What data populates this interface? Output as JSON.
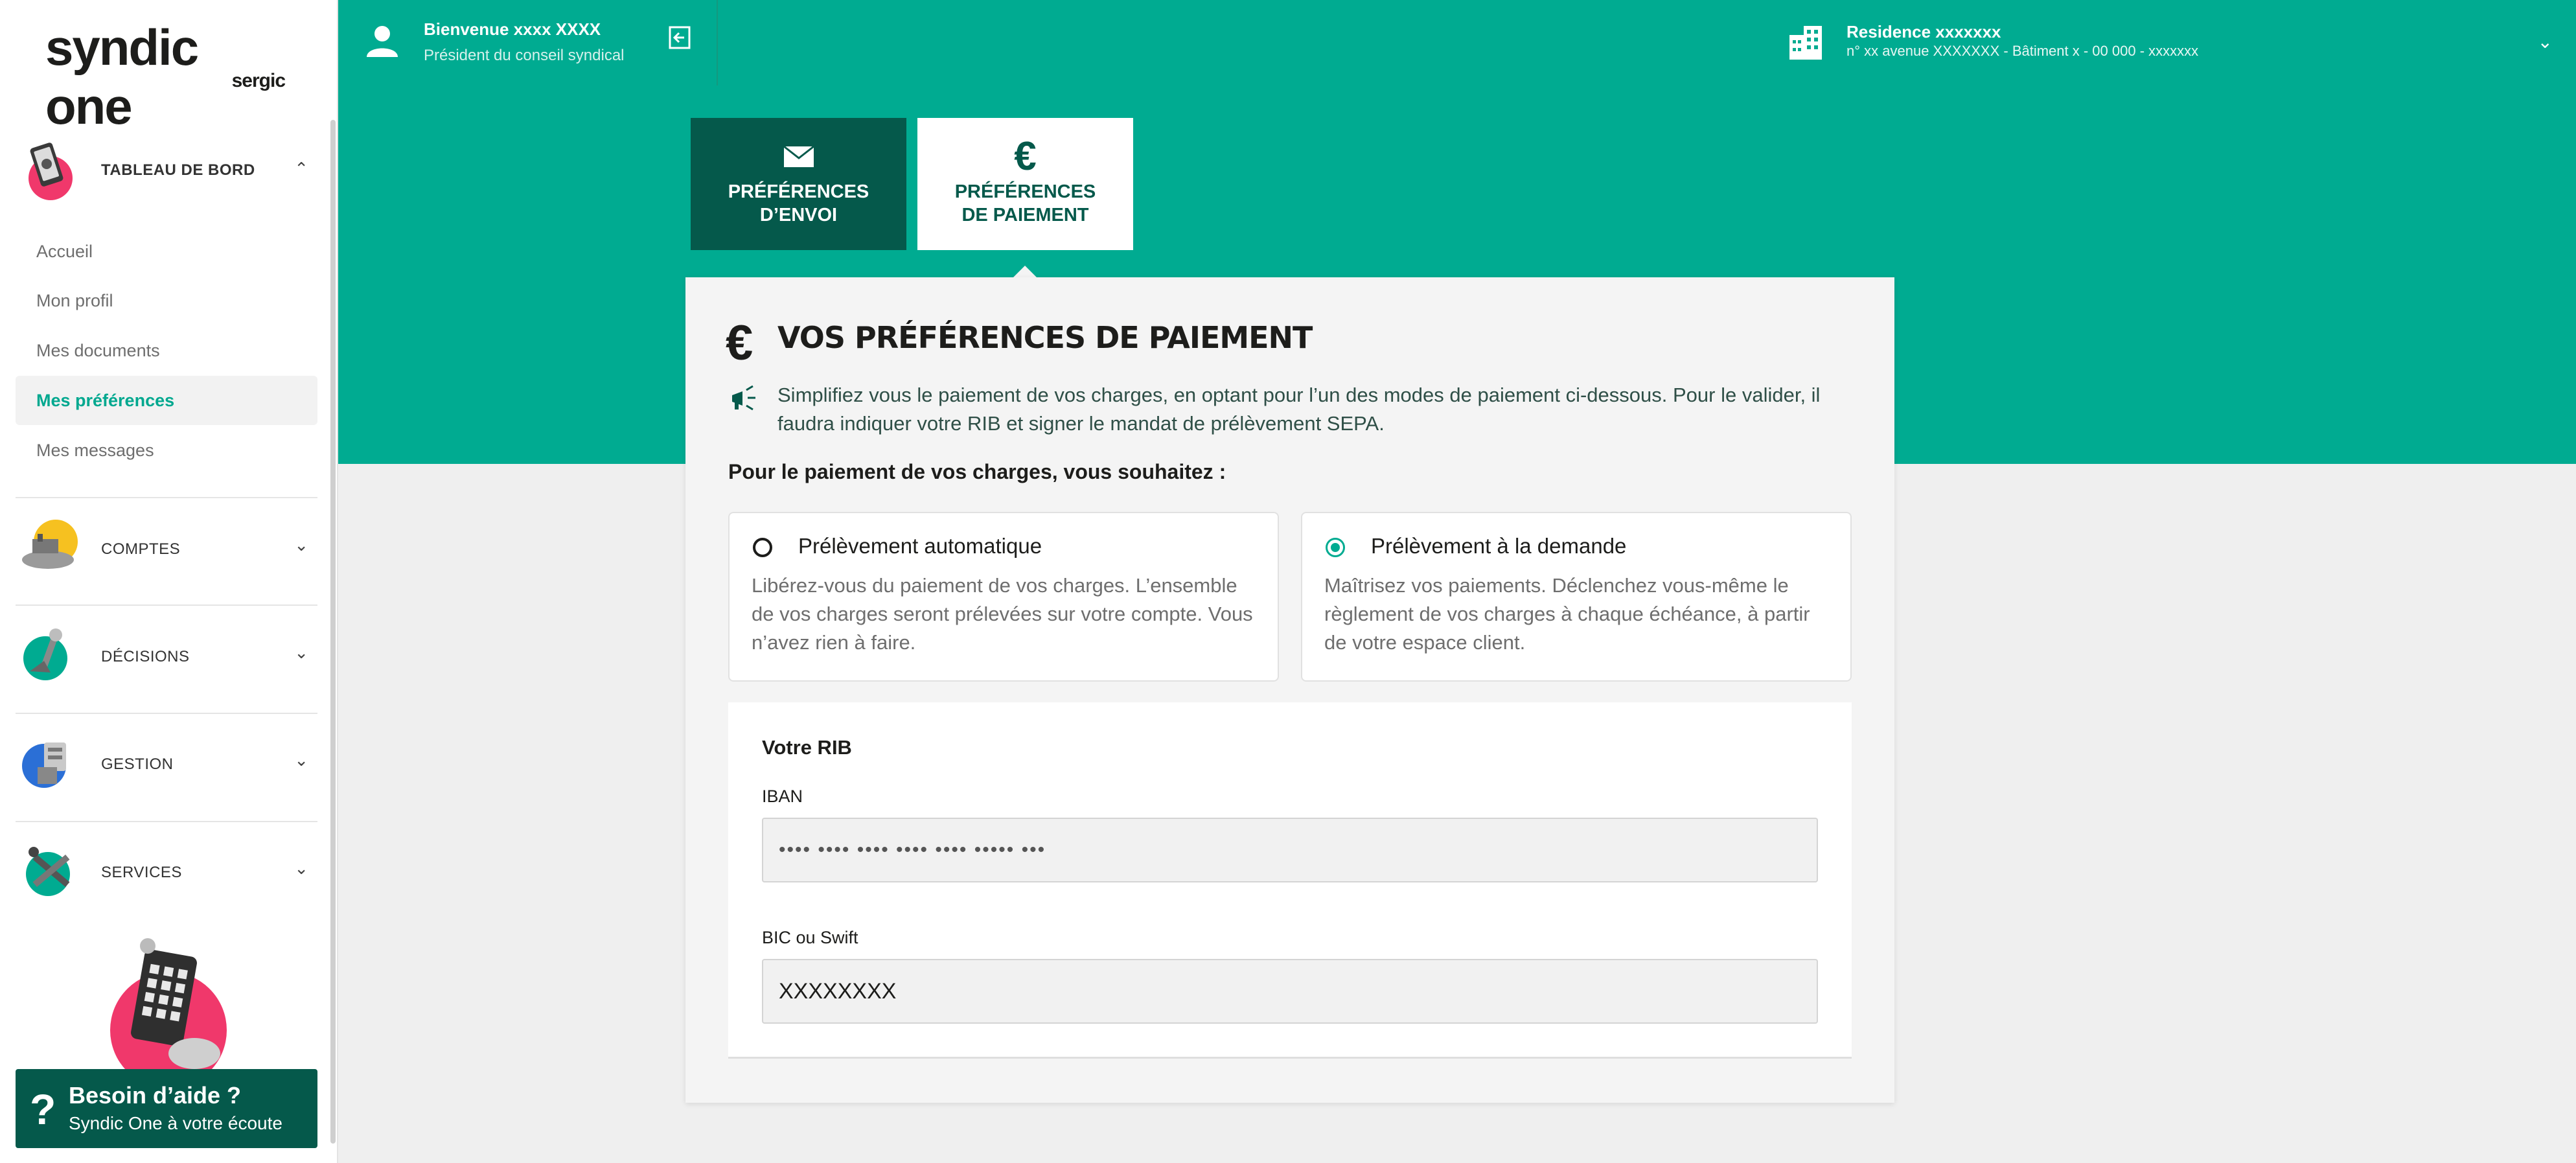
{
  "brand": {
    "name": "syndic one",
    "sub": "sergic"
  },
  "topbar": {
    "welcome": "Bienvenue xxxx XXXX",
    "role": "Président du conseil syndical",
    "residence_name": "Residence xxxxxxx",
    "residence_address": "n° xx avenue XXXXXXX - Bâtiment x - 00 000 - xxxxxxx"
  },
  "sidebar": {
    "sections": [
      {
        "label": "TABLEAU DE BORD",
        "expanded": true
      },
      {
        "label": "COMPTES",
        "expanded": false
      },
      {
        "label": "DÉCISIONS",
        "expanded": false
      },
      {
        "label": "GESTION",
        "expanded": false
      },
      {
        "label": "SERVICES",
        "expanded": false
      }
    ],
    "items": [
      {
        "label": "Accueil",
        "active": false
      },
      {
        "label": "Mon profil",
        "active": false
      },
      {
        "label": "Mes documents",
        "active": false
      },
      {
        "label": "Mes préférences",
        "active": true
      },
      {
        "label": "Mes messages",
        "active": false
      }
    ],
    "help": {
      "title": "Besoin d’aide ?",
      "subtitle": "Syndic One à votre écoute"
    }
  },
  "tabs": [
    {
      "label": "PRÉFÉRENCES D’ENVOI",
      "active": false
    },
    {
      "label": "PRÉFÉRENCES DE PAIEMENT",
      "active": true
    }
  ],
  "main": {
    "title": "VOS PRÉFÉRENCES DE PAIEMENT",
    "info": "Simplifiez vous le paiement de vos charges, en optant pour l’un des modes de paiement ci-dessous. Pour le valider, il faudra indiquer votre RIB et signer le mandat de prélèvement SEPA.",
    "question": "Pour le paiement de vos charges, vous souhaitez :",
    "options": [
      {
        "title": "Prélèvement automatique",
        "description": "Libérez-vous du paiement de vos charges. L’ensemble de vos charges seront prélevées sur votre compte. Vous n’avez rien à faire.",
        "selected": false
      },
      {
        "title": "Prélèvement à la demande",
        "description": "Maîtrisez vos paiements. Déclenchez vous-même le règlement de vos charges à chaque échéance, à partir de votre espace client.",
        "selected": true
      }
    ],
    "rib": {
      "title": "Votre RIB",
      "iban_label": "IBAN",
      "iban_value": "•••• •••• •••• •••• •••• ••••• •••",
      "bic_label": "BIC ou Swift",
      "bic_value": "XXXXXXXX"
    }
  },
  "colors": {
    "primary": "#00ab91",
    "dark": "#05594b",
    "accent": "#f0386b",
    "background": "#efefef"
  },
  "icons": {
    "user": "user-icon",
    "logout": "logout-icon",
    "building": "building-icon",
    "envelope": "envelope-icon",
    "euro": "euro-icon",
    "megaphone": "megaphone-icon",
    "help": "question-icon"
  }
}
